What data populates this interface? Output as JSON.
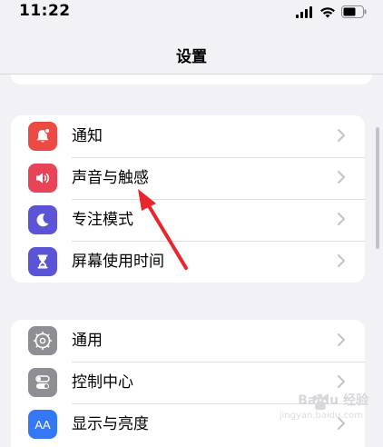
{
  "status_bar": {
    "time": "11:22"
  },
  "nav": {
    "title": "设置"
  },
  "groups": [
    {
      "items": [
        {
          "label": "通知",
          "icon": "notification-bell-icon",
          "color": "#ec4b43"
        },
        {
          "label": "声音与触感",
          "icon": "speaker-icon",
          "color": "#e84357"
        },
        {
          "label": "专注模式",
          "icon": "moon-icon",
          "color": "#5b54d6"
        },
        {
          "label": "屏幕使用时间",
          "icon": "hourglass-icon",
          "color": "#5b54d6"
        }
      ]
    },
    {
      "items": [
        {
          "label": "通用",
          "icon": "gear-icon",
          "color": "#8e8e93"
        },
        {
          "label": "控制中心",
          "icon": "toggles-icon",
          "color": "#8e8e93"
        },
        {
          "label": "显示与亮度",
          "icon": "text-size-icon",
          "color": "#3478f6",
          "glyph": "AA"
        }
      ]
    }
  ],
  "watermark": {
    "text": "Baidu 经验",
    "sub": "jingyan.baidu.com"
  },
  "annotation": {
    "type": "red-arrow",
    "color": "#e8262d",
    "points_to": "声音与触感"
  }
}
